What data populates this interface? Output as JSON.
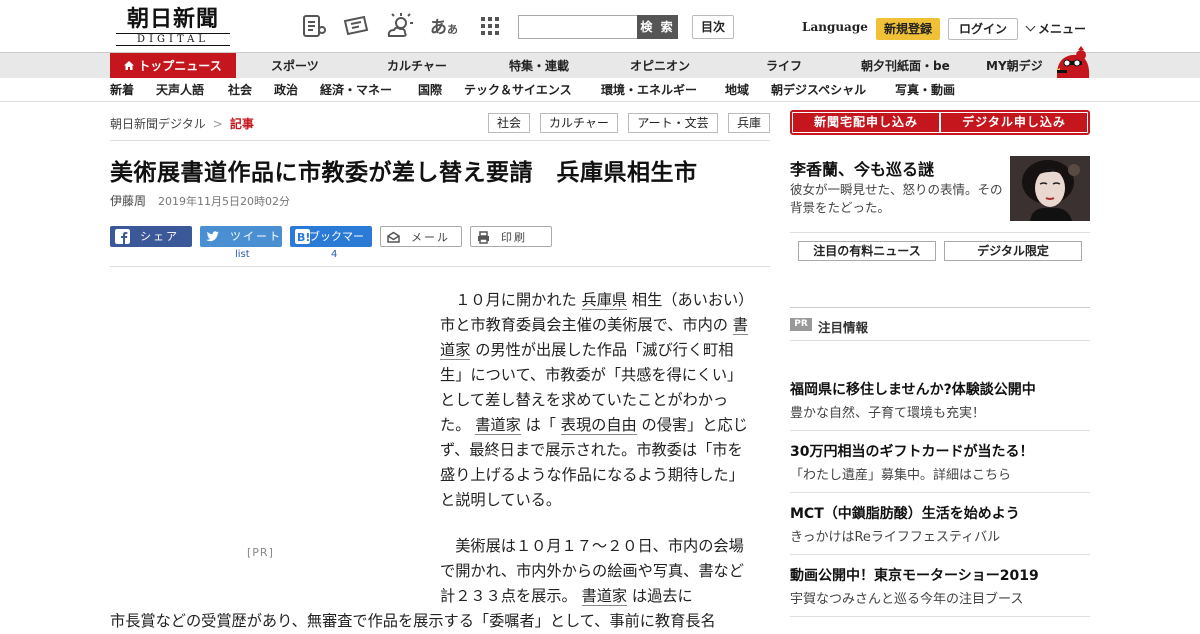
{
  "header": {
    "logo_main": "朝日新聞",
    "logo_sub": "DIGITAL",
    "search_button": "検 索",
    "search_placeholder": "",
    "toc_button": "目次",
    "language": "Language",
    "register": "新規登録",
    "login": "ログイン",
    "menu": "メニュー",
    "font_size_icon_label": "あ",
    "font_size_icon_small": "あ"
  },
  "main_nav": [
    "トップニュース",
    "スポーツ",
    "カルチャー",
    "特集・連載",
    "オピニオン",
    "ライフ",
    "朝夕刊紙面・be",
    "MY朝デジ"
  ],
  "sub_nav": [
    "新着",
    "天声人語",
    "社会",
    "政治",
    "経済・マネー",
    "国際",
    "テック＆サイエンス",
    "環境・エネルギー",
    "地域",
    "朝デジスペシャル",
    "写真・動画"
  ],
  "breadcrumb": {
    "site": "朝日新聞デジタル",
    "separator": ">",
    "current": "記事"
  },
  "tags": [
    "社会",
    "カルチャー",
    "アート・文芸",
    "兵庫"
  ],
  "article": {
    "headline": "美術展書道作品に市教委が差し替え要請　兵庫県相生市",
    "author": "伊藤周",
    "date": "2019年11月5日20時02分",
    "paragraph1": [
      {
        "t": "　１０月に開かれた "
      },
      {
        "t": "兵庫県",
        "link": true
      },
      {
        "t": " 相生（あいおい）市と市教育委員会主催の美術展で、市内の "
      },
      {
        "t": "書道家",
        "link": true
      },
      {
        "t": " の男性が出展した作品「滅び行く町相生」について、市教委が「共感を得にくい」として差し替えを求めていたことがわかった。 "
      },
      {
        "t": "書道家",
        "link": true
      },
      {
        "t": " は「 "
      },
      {
        "t": "表現の自由",
        "link": true
      },
      {
        "t": " の侵害」と応じず、最終日まで展示された。市教委は「市を盛り上げるような作品になるよう期待した」と説明している。"
      }
    ],
    "paragraph2": [
      {
        "t": "　美術展は１０月１７～２０日、市内の会場で開かれ、市内外からの絵画や写真、書など計２３３点を展示。 "
      },
      {
        "t": "書道家",
        "link": true
      },
      {
        "t": " は過去に"
      }
    ],
    "paragraph3": "市長賞などの受賞歴があり、無審査で作品を展示する「委嘱者」として、事前に教育長名",
    "pr_label": "[PR]"
  },
  "share": {
    "facebook": "シェア",
    "twitter": "ツイート",
    "hatena": "ブックマーク",
    "mail": "メール",
    "print": "印刷",
    "twitter_count": "list",
    "hatena_count": "4",
    "colors": {
      "facebook": "#3b5998",
      "twitter": "#4a8fd2",
      "hatena": "#2b7bd6"
    }
  },
  "sidebar": {
    "cta_left": "新聞宅配申し込み",
    "cta_right": "デジタル申し込み",
    "promo_title": "李香蘭、今も巡る謎",
    "promo_desc": "彼女が一瞬見せた、怒りの表情。その背景をたどった。",
    "pill_left": "注目の有料ニュース",
    "pill_right": "デジタル限定",
    "pr_badge": "PR",
    "pr_heading": "注目情報",
    "ads": [
      {
        "title": "福岡県に移住しませんか?体験談公開中",
        "sub": "豊かな自然、子育て環境も充実！"
      },
      {
        "title": "30万円相当のギフトカードが当たる！",
        "sub": "「わたし遺産」募集中。詳細はこちら"
      },
      {
        "title": "MCT（中鎖脂肪酸）生活を始めよう",
        "sub": "きっかけはReライフフェスティバル"
      },
      {
        "title": "動画公開中！東京モーターショー2019",
        "sub": "宇賀なつみさんと巡る今年の注目ブース"
      }
    ]
  },
  "colors": {
    "brand_red": "#c4161c",
    "register_yellow": "#f0c136"
  }
}
